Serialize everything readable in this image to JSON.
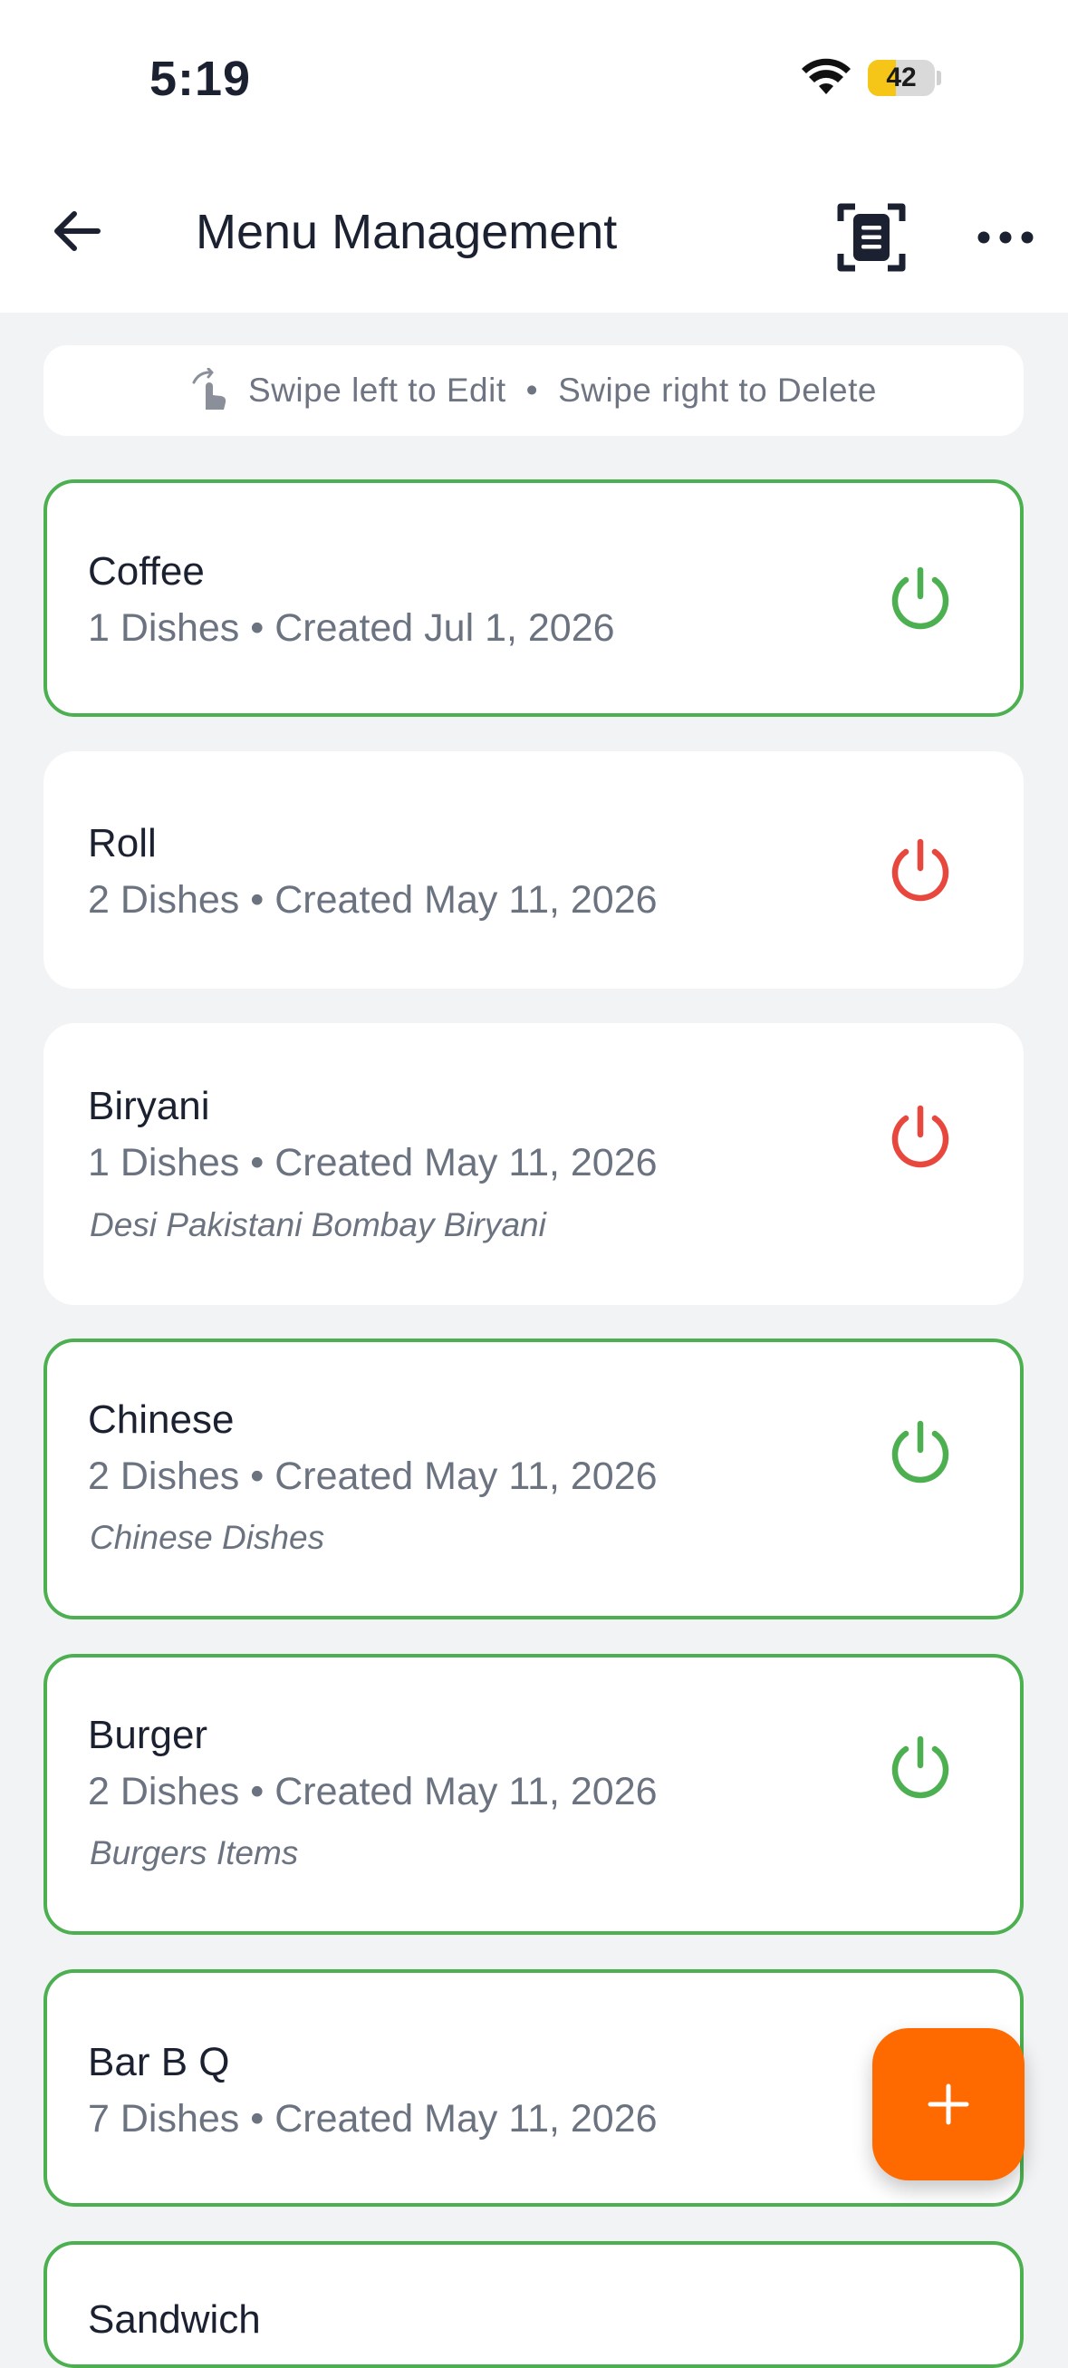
{
  "status_bar": {
    "time": "5:19",
    "battery": "42",
    "battery_level": 0.42
  },
  "header": {
    "title": "Menu Management"
  },
  "hint": {
    "edit": "Swipe left to Edit",
    "separator": "•",
    "delete": "Swipe right to Delete"
  },
  "colors": {
    "active": "#4caf50",
    "inactive": "#e8473e",
    "accent": "#ff6a00"
  },
  "categories": [
    {
      "name": "Coffee",
      "meta": "1 Dishes • Created Jul 1, 2026",
      "description": "",
      "active": true
    },
    {
      "name": "Roll",
      "meta": "2 Dishes • Created May 11, 2026",
      "description": "",
      "active": false
    },
    {
      "name": "Biryani",
      "meta": "1 Dishes • Created May 11, 2026",
      "description": "Desi Pakistani Bombay Biryani",
      "active": false
    },
    {
      "name": "Chinese",
      "meta": "2 Dishes • Created May 11, 2026",
      "description": "Chinese Dishes",
      "active": true
    },
    {
      "name": "Burger",
      "meta": "2 Dishes • Created May 11, 2026",
      "description": "Burgers Items",
      "active": true
    },
    {
      "name": "Bar B Q",
      "meta": "7 Dishes • Created May 11, 2026",
      "description": "",
      "active": true
    },
    {
      "name": "Sandwich",
      "meta": "",
      "description": "",
      "active": true
    }
  ],
  "icons": {
    "back": "arrow-left-icon",
    "scan": "document-scan-icon",
    "more": "more-horizontal-icon",
    "toggle": "power-icon",
    "hint": "swipe-hand-icon",
    "add": "plus-icon"
  }
}
